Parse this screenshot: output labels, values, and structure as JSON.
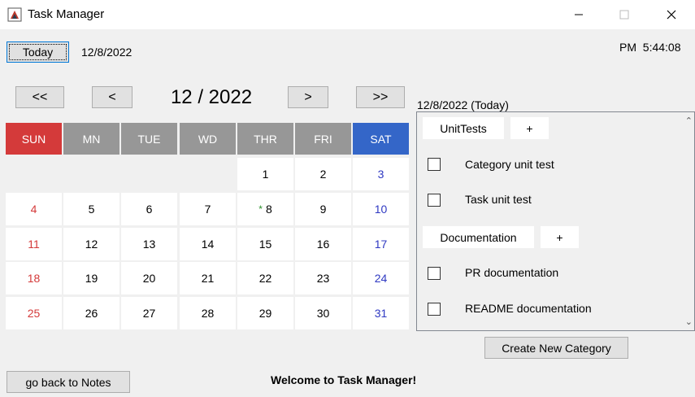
{
  "window": {
    "title": "Task Manager",
    "app_icon": "java-cup-icon"
  },
  "header": {
    "today_button": "Today",
    "today_date": "12/8/2022",
    "clock": "PM  5:44:08"
  },
  "calendar": {
    "nav": {
      "prev_year": "<<",
      "prev_month": "<",
      "month_year": "12 / 2022",
      "next_month": ">",
      "next_year": ">>"
    },
    "days": [
      "SUN",
      "MN",
      "TUE",
      "WD",
      "THR",
      "FRI",
      "SAT"
    ],
    "day_colors": {
      "sun": "#d43a3a",
      "weekday": "#979797",
      "sat": "#3466c8"
    },
    "weeks": [
      [
        "",
        "",
        "",
        "",
        "1",
        "2",
        "3"
      ],
      [
        "4",
        "5",
        "6",
        "7",
        "8",
        "9",
        "10"
      ],
      [
        "11",
        "12",
        "13",
        "14",
        "15",
        "16",
        "17"
      ],
      [
        "18",
        "19",
        "20",
        "21",
        "22",
        "23",
        "24"
      ],
      [
        "25",
        "26",
        "27",
        "28",
        "29",
        "30",
        "31"
      ]
    ],
    "today_marker": "*"
  },
  "tasks": {
    "selected_date": "12/8/2022 (Today)",
    "categories": [
      {
        "name": "UnitTests",
        "add": "+",
        "items": [
          "Category unit test",
          "Task unit test"
        ]
      },
      {
        "name": "Documentation",
        "add": "+",
        "items": [
          "PR documentation",
          "README documentation"
        ]
      }
    ],
    "create_button": "Create New Category"
  },
  "footer": {
    "back_button": "go back to Notes",
    "welcome": "Welcome to Task Manager!"
  }
}
